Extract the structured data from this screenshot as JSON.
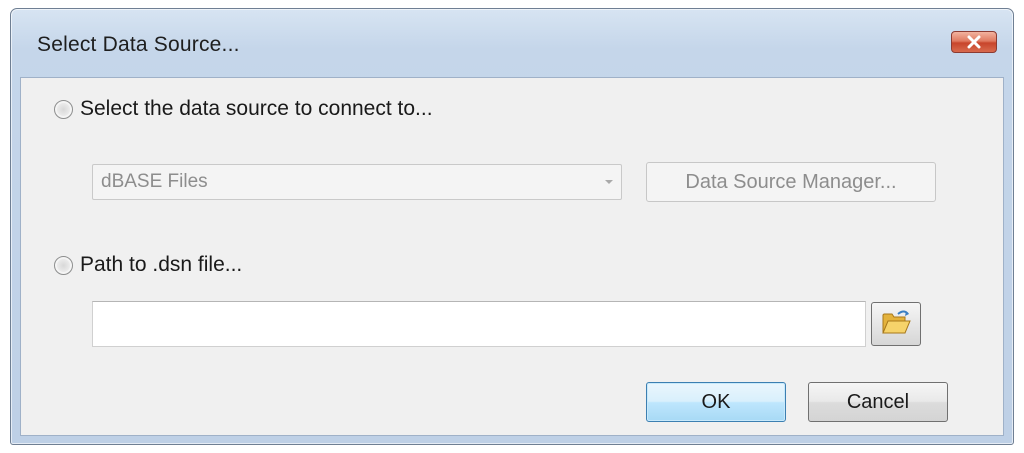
{
  "dialog": {
    "title": "Select Data Source...",
    "close_icon": "close-icon"
  },
  "options": {
    "data_source_radio_label": "Select the data source to connect to...",
    "data_source_selected": "dBASE Files",
    "data_source_manager_label": "Data Source Manager...",
    "dsn_radio_label": "Path to .dsn file...",
    "dsn_path_value": "",
    "browse_icon": "open-folder-icon"
  },
  "buttons": {
    "ok_label": "OK",
    "cancel_label": "Cancel"
  },
  "colors": {
    "close_button": "#c8452b",
    "default_button_border": "#3c7fb1",
    "disabled_text": "#8d8d8d"
  }
}
